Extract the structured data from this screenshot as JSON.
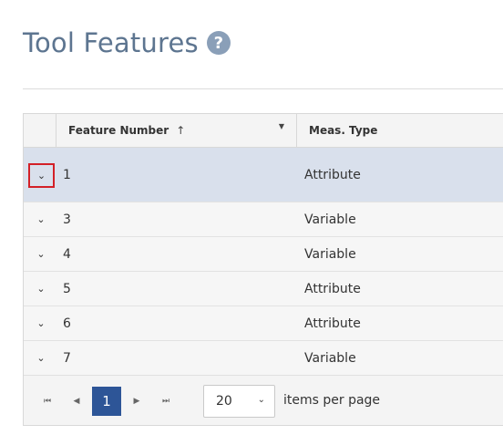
{
  "page": {
    "title": "Tool Features",
    "help_glyph": "?"
  },
  "grid": {
    "columns": {
      "feature_number": "Feature Number",
      "sort_glyph": "↑",
      "filter_glyph": "▼",
      "meas_type": "Meas. Type"
    },
    "expand_glyph": "⌄",
    "rows": [
      {
        "feature": "1",
        "meas": "Attribute"
      },
      {
        "feature": "3",
        "meas": "Variable"
      },
      {
        "feature": "4",
        "meas": "Variable"
      },
      {
        "feature": "5",
        "meas": "Attribute"
      },
      {
        "feature": "6",
        "meas": "Attribute"
      },
      {
        "feature": "7",
        "meas": "Variable"
      }
    ]
  },
  "pager": {
    "first_glyph": "⏮",
    "prev_glyph": "◀",
    "current_page": "1",
    "next_glyph": "▶",
    "last_glyph": "⏭",
    "page_size": "20",
    "size_chevron": "⌄",
    "items_label": "items per page"
  }
}
